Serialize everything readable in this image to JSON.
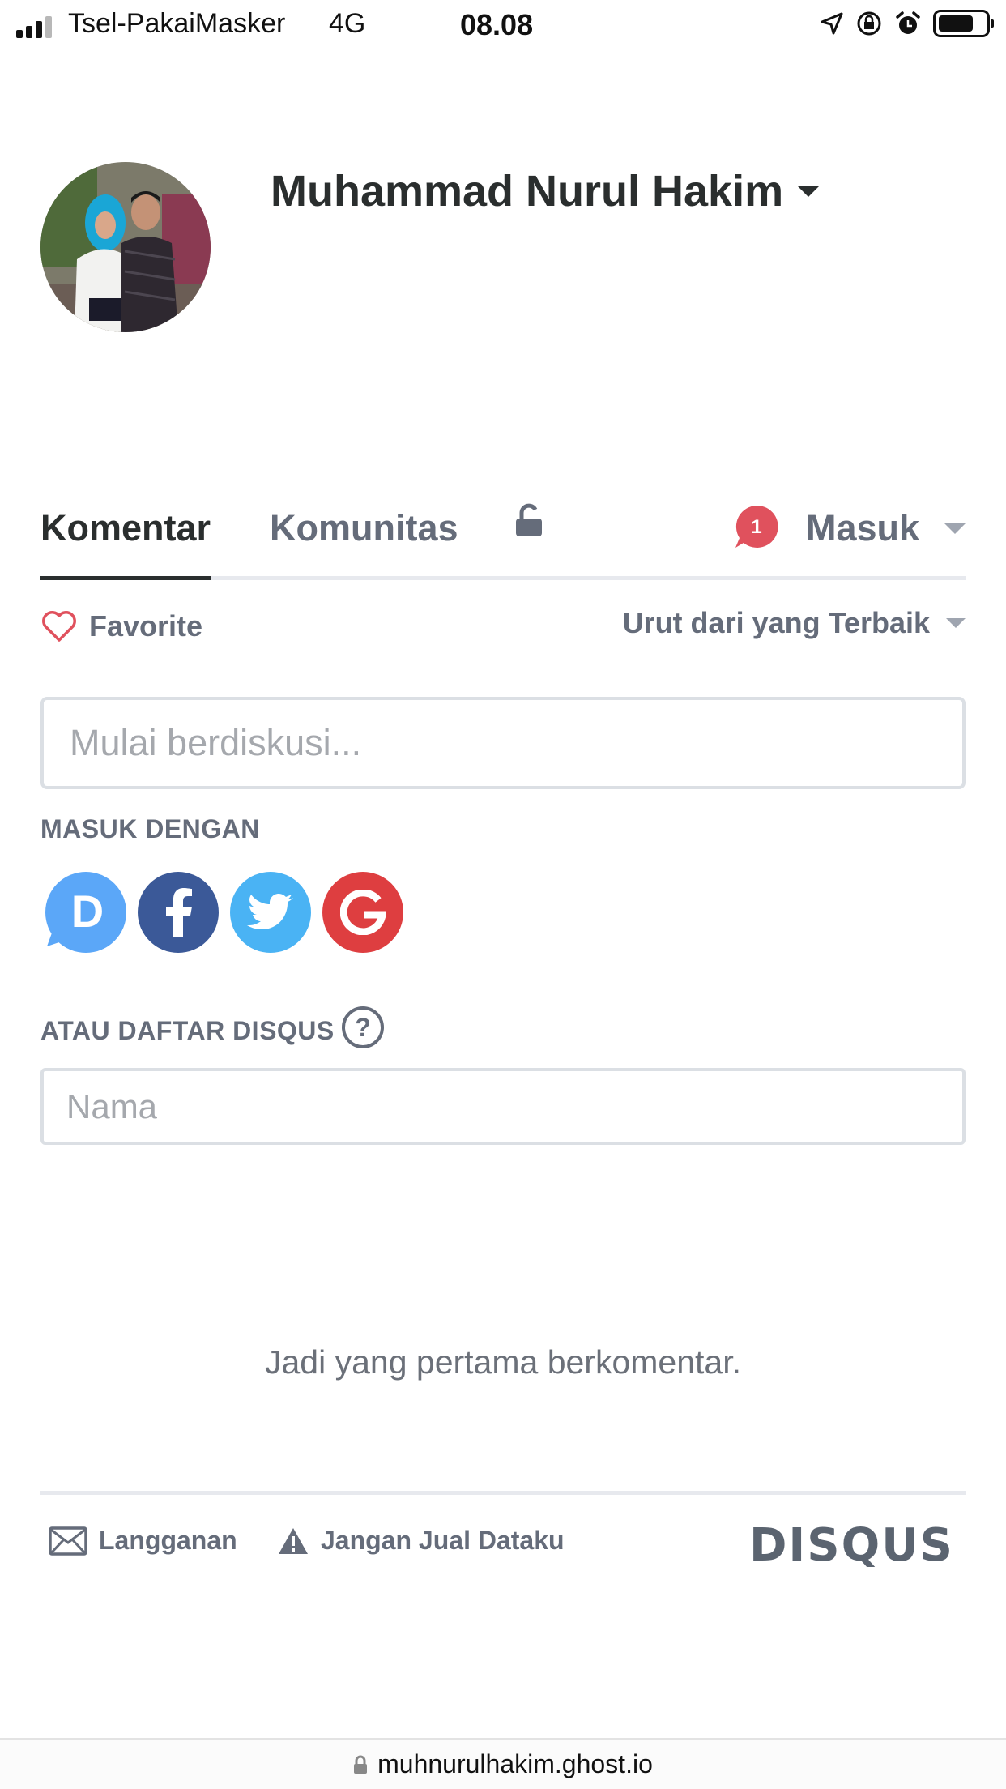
{
  "status_bar": {
    "carrier": "Tsel-PakaiMasker",
    "network": "4G",
    "time": "08.08"
  },
  "profile": {
    "name": "Muhammad Nurul Hakim"
  },
  "tabs": {
    "comments": "Komentar",
    "community": "Komunitas",
    "notification_count": "1",
    "login": "Masuk"
  },
  "toolbar": {
    "favorite": "Favorite",
    "sort": "Urut dari yang Terbaik"
  },
  "comment_box": {
    "placeholder": "Mulai berdiskusi...",
    "value": ""
  },
  "login_with": {
    "label": "MASUK DENGAN",
    "providers": [
      "Disqus",
      "Facebook",
      "Twitter",
      "Google"
    ],
    "colors": {
      "disqus": "#5ba7f8",
      "facebook": "#3b5998",
      "twitter": "#4ab3f4",
      "google": "#de3e40"
    }
  },
  "register": {
    "label": "ATAU DAFTAR DISQUS",
    "name_placeholder": "Nama"
  },
  "empty_message": "Jadi yang pertama berkomentar.",
  "footer": {
    "subscribe": "Langganan",
    "do_not_sell": "Jangan Jual Dataku",
    "brand": "DISQUS"
  },
  "url_bar": {
    "domain": "muhnurulhakim.ghost.io"
  }
}
